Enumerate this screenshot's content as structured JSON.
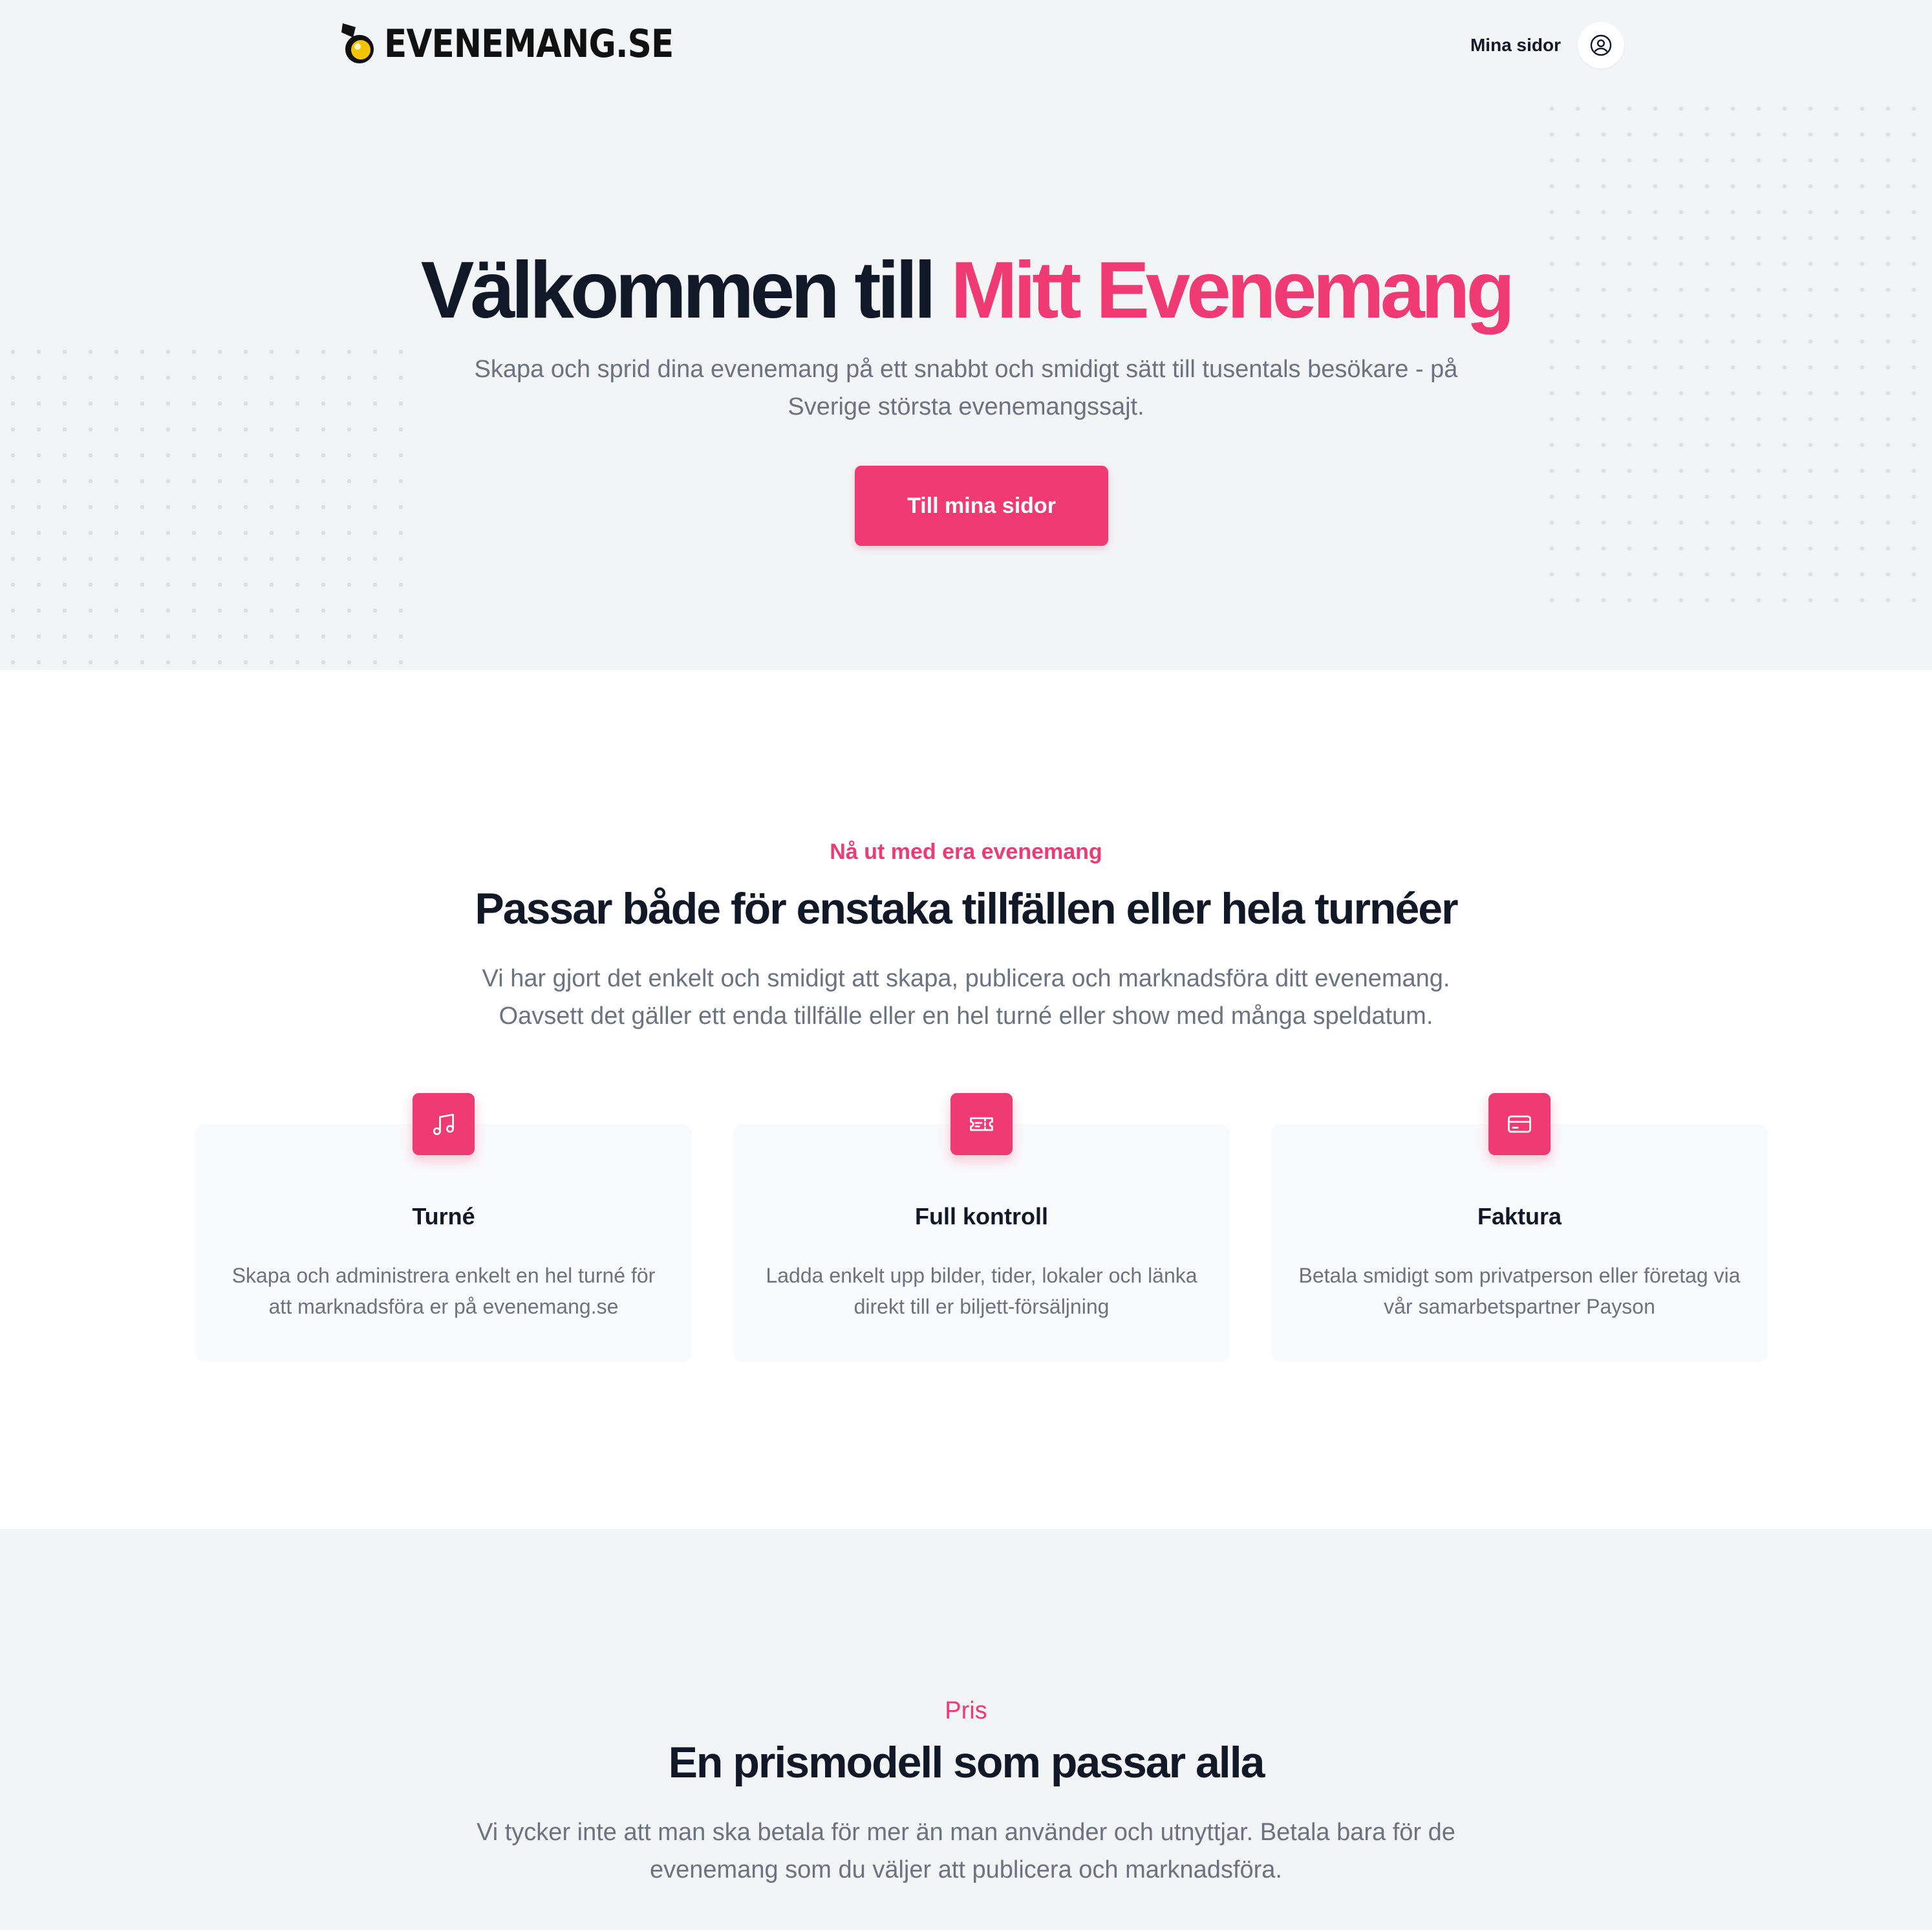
{
  "header": {
    "logo_text": "EVENEMANG.SE",
    "nav_link": "Mina sidor",
    "avatar_icon": "user-circle-icon"
  },
  "hero": {
    "title_prefix": "Välkommen till",
    "title_accent": "Mitt Evenemang",
    "subtitle": "Skapa och sprid dina evenemang på ett snabbt och smidigt sätt till tusentals besökare - på Sverige största evenemangssajt.",
    "button_label": "Till mina sidor"
  },
  "features": {
    "eyebrow": "Nå ut med era evenemang",
    "title": "Passar både för enstaka tillfällen eller hela turnéer",
    "subtitle": "Vi har gjort det enkelt och smidigt att skapa, publicera och marknadsföra ditt evenemang. Oavsett det gäller ett enda tillfälle eller en hel turné eller show med många speldatum.",
    "cards": [
      {
        "icon": "music-note-icon",
        "title": "Turné",
        "text": "Skapa och administrera enkelt en hel turné för att marknadsföra er på evenemang.se"
      },
      {
        "icon": "ticket-icon",
        "title": "Full kontroll",
        "text": "Ladda enkelt upp bilder, tider, lokaler och länka direkt till er biljett-försäljning"
      },
      {
        "icon": "credit-card-icon",
        "title": "Faktura",
        "text": "Betala smidigt som privatperson eller företag via vår samarbetspartner Payson"
      }
    ]
  },
  "pricing": {
    "eyebrow": "Pris",
    "title": "En prismodell som passar alla",
    "subtitle": "Vi tycker inte att man ska betala för mer än man använder och utnyttjar. Betala bara för de evenemang som du väljer att publicera och marknadsföra."
  },
  "colors": {
    "accent": "#f03a73",
    "heading": "#111827",
    "muted": "#6b7280",
    "hero_bg": "#f3f4f6",
    "card_bg": "#f9fafb"
  }
}
